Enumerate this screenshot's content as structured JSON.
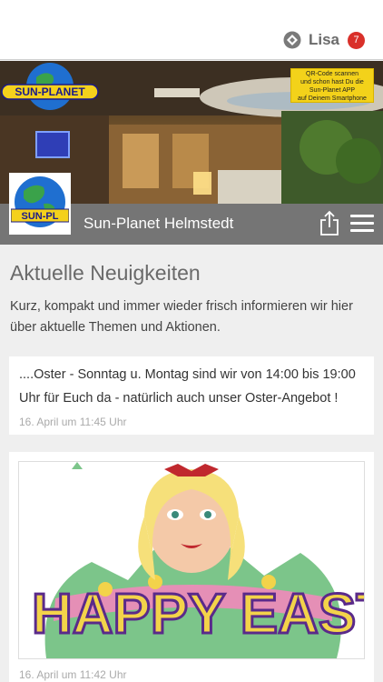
{
  "header": {
    "user_name": "Lisa",
    "notification_count": "7"
  },
  "hero": {
    "logo_text": "SUN-PLANET",
    "qr_note": [
      "QR-Code scannen",
      "und schon hast Du die",
      "Sun-Planet APP",
      "auf Deinem Smartphone"
    ],
    "shop_title": "Sun-Planet Helmstedt",
    "logo_tile_text": "SUN-PL"
  },
  "news": {
    "title": "Aktuelle Neuigkeiten",
    "intro": "Kurz, kompakt und immer wieder frisch informieren wir hier über aktuelle Themen und Aktionen.",
    "posts": [
      {
        "text": "....Oster - Sonntag u. Montag sind wir von 14:00 bis 19:00 Uhr für Euch da - natürlich auch unser Oster-Angebot !",
        "date": "16. April um 11:45 Uhr"
      },
      {
        "image_text": "HAPPY EASTER",
        "date": "16. April um 11:42 Uhr"
      }
    ]
  },
  "colors": {
    "badge": "#d9302a",
    "titlebar": "#6e6e6e",
    "qr_note": "#f3d21a"
  }
}
